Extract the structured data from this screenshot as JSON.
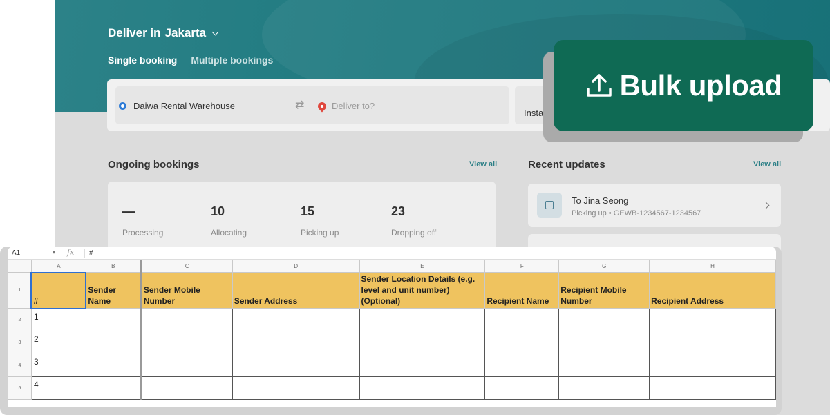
{
  "app": {
    "deliver_prefix": "Deliver in",
    "city": "Jakarta",
    "tabs": [
      "Single booking",
      "Multiple bookings"
    ],
    "pickup_location": "Daiwa Rental Warehouse",
    "dropoff_placeholder": "Deliver to?",
    "service_type": "Instant",
    "ongoing": {
      "title": "Ongoing bookings",
      "view_all": "View all",
      "stats": [
        {
          "value": "—",
          "label": "Processing"
        },
        {
          "value": "10",
          "label": "Allocating"
        },
        {
          "value": "15",
          "label": "Picking up"
        },
        {
          "value": "23",
          "label": "Dropping off"
        }
      ]
    },
    "recent": {
      "title": "Recent updates",
      "view_all": "View all",
      "items": [
        {
          "title": "To Jina Seong",
          "subtitle": "Picking up • GEWB-1234567-1234567"
        }
      ]
    }
  },
  "bulk_upload": {
    "label": "Bulk upload",
    "icon": "upload-icon"
  },
  "sheet": {
    "cell_ref": "A1",
    "formula_value": "#",
    "columns": [
      "A",
      "B",
      "C",
      "D",
      "E",
      "F",
      "G",
      "H"
    ],
    "row_numbers": [
      "1",
      "2",
      "3",
      "4",
      "5"
    ],
    "headers": [
      "#",
      "Sender Name",
      "Sender Mobile Number",
      "Sender Address",
      "Sender Location Details (e.g. level and unit number) (Optional)",
      "Recipient Name",
      "Recipient Mobile Number",
      "Recipient Address"
    ],
    "rows": [
      "1",
      "2",
      "3",
      "4"
    ]
  },
  "colors": {
    "hero": "#1f7a80",
    "bulk_button": "#0f6a54",
    "header_fill": "#efc35f"
  }
}
